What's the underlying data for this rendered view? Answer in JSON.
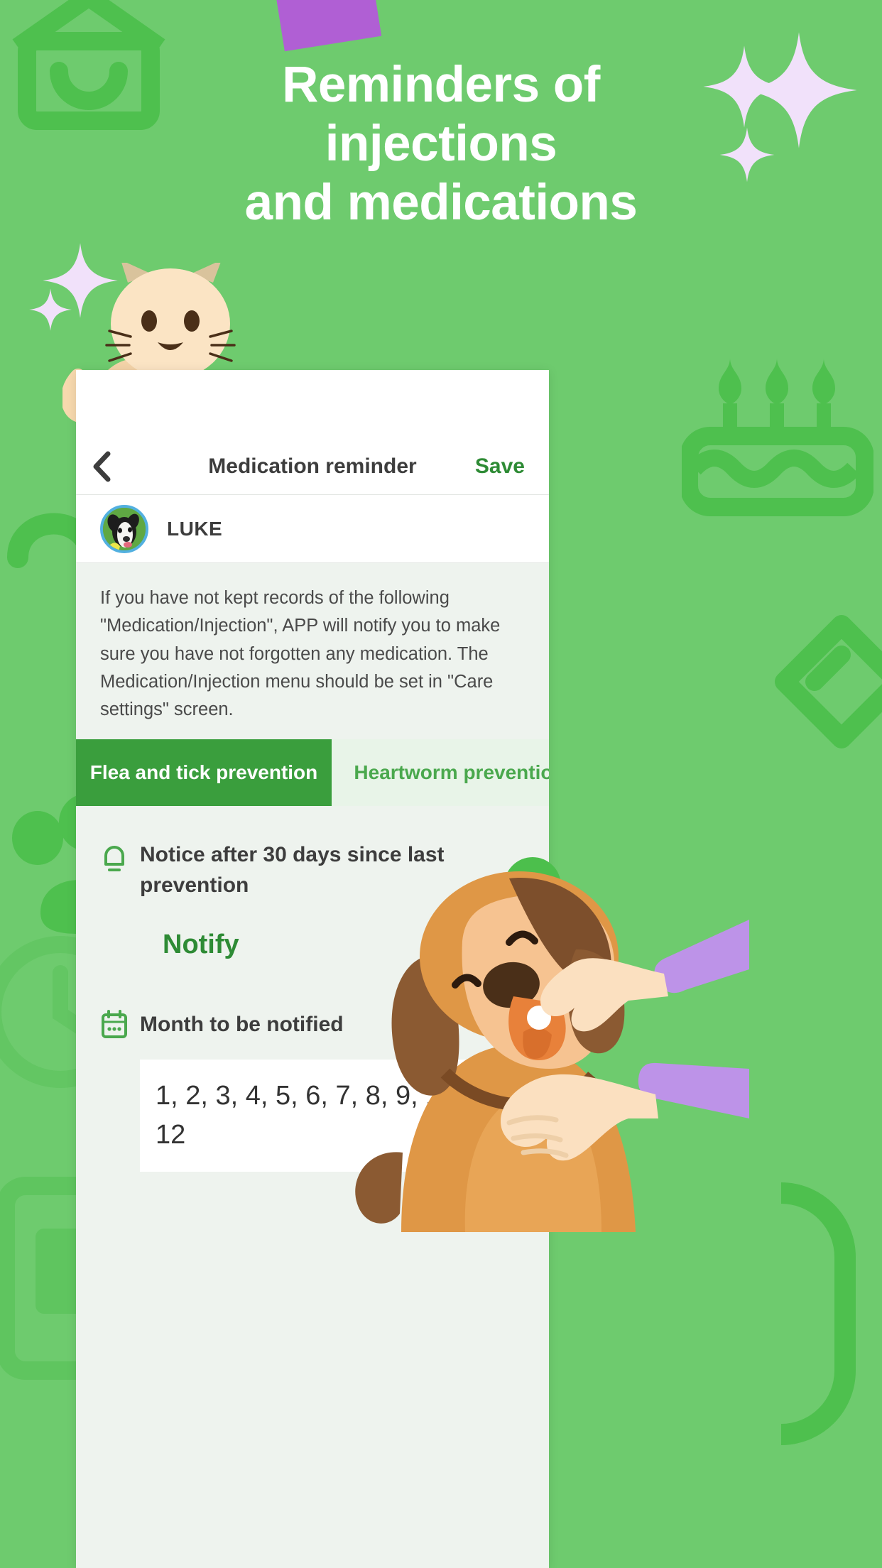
{
  "colors": {
    "bg_green": "#6ecb6e",
    "decor_green": "#4ec04e",
    "brand_green": "#3a9e3d",
    "save_green": "#2e8b35",
    "tab_inactive_bg": "#e8f4e8",
    "card_bg": "#eef3ee",
    "sparkle_lavender": "#f1e1fa",
    "sticky_purple": "#b05fd4",
    "avatar_ring": "#52b0e0"
  },
  "headline": {
    "line1": "Reminders of",
    "line2": "injections",
    "line3": "and medications"
  },
  "nav": {
    "back_icon": "chevron-left-icon",
    "title": "Medication reminder",
    "save_label": "Save"
  },
  "pet": {
    "avatar_icon": "dog-photo-avatar",
    "name": "LUKE"
  },
  "description": "If you have not kept records of the following \"Medication/Injection\", APP will notify you to make sure you have not forgotten any medication. The Medication/Injection menu should be set in \"Care settings\" screen.",
  "tabs": [
    {
      "label": "Flea and tick prevention",
      "active": true
    },
    {
      "label": "Heartworm prevention",
      "active": false
    }
  ],
  "settings": {
    "bell_icon": "bell-icon",
    "notice_label": "Notice after 30 days since last prevention",
    "notify_value": "Notify",
    "calendar_icon": "calendar-icon",
    "month_label": "Month to be notified",
    "month_value": "1, 2, 3, 4, 5, 6, 7, 8, 9, 10, 11, 12"
  },
  "decor": {
    "house_icon": "house-smile-icon",
    "cake_icon": "birthday-cake-icon",
    "bone_icon": "bone-icon",
    "paw_icon": "paw-print-icon",
    "heart_icon": "heart-icon",
    "tag_icon": "pet-tag-icon",
    "clock_icon": "clock-icon",
    "cat_icon": "cat-illustration",
    "dog_icon": "dog-with-pill-illustration",
    "sparkle_icon": "sparkle-icon"
  }
}
